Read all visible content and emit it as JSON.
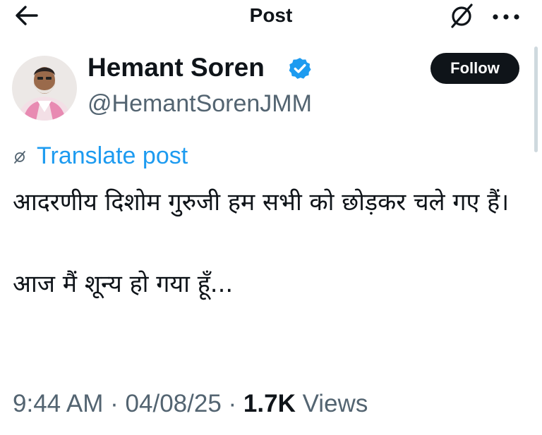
{
  "header": {
    "title": "Post"
  },
  "author": {
    "name": "Hemant Soren",
    "handle": "@HemantSorenJMM",
    "verified": true
  },
  "follow_label": "Follow",
  "translate_label": "Translate post",
  "tweet": {
    "paragraphs": [
      "आदरणीय दिशोम गुरुजी हम सभी को छोड़कर चले गए हैं।",
      "आज मैं शून्य हो गया हूँ..."
    ]
  },
  "meta": {
    "time": "9:44 AM",
    "separator": "·",
    "date": "04/08/25",
    "views_count": "1.7K",
    "views_label": "Views"
  },
  "icons": {
    "back": "arrow-left-icon",
    "translate": "grok-icon",
    "more": "more-horizontal-icon",
    "verified": "verified-badge-icon"
  },
  "colors": {
    "accent": "#1d9bf0",
    "text": "#0f1419",
    "secondary": "#536471",
    "follow_bg": "#0f1419"
  }
}
